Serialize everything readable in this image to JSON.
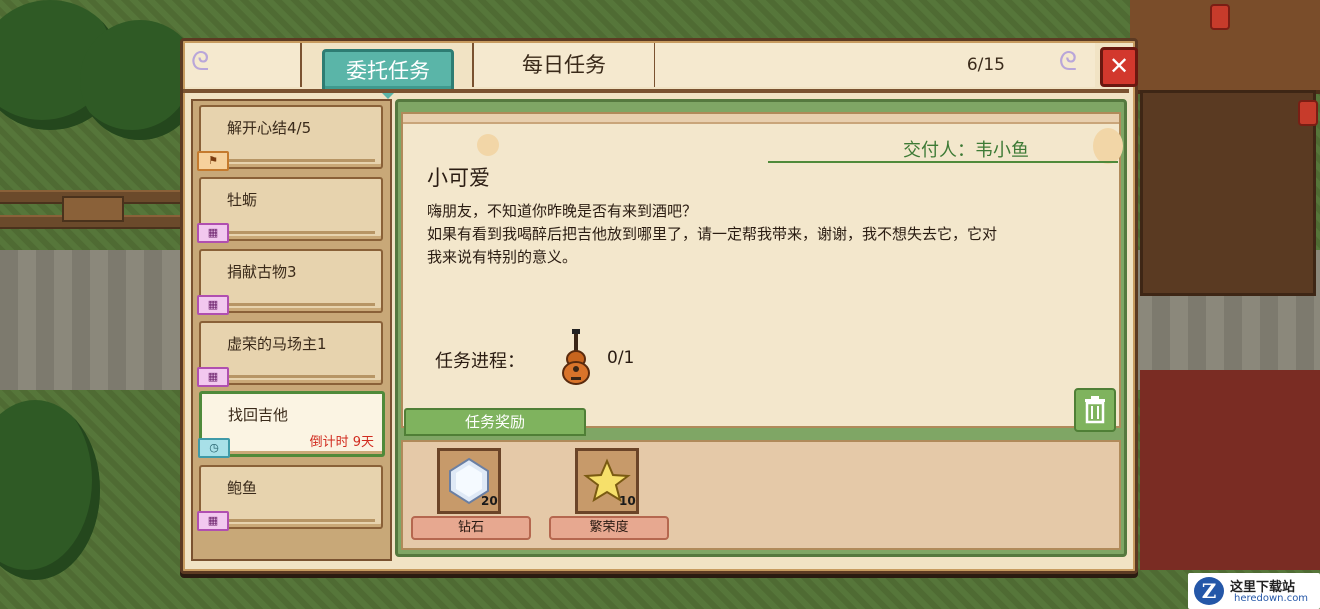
{
  "tabs": {
    "active_label": "委托任务",
    "inactive_label": "每日任务",
    "task_count": "6/15"
  },
  "task_list": [
    {
      "name": "解开心结4/5",
      "badge": "flag-icon",
      "badge_color": "#c47a2e"
    },
    {
      "name": "牡蛎",
      "badge": "calendar-icon",
      "badge_color": "#b04fb0"
    },
    {
      "name": "捐献古物3",
      "badge": "calendar-icon",
      "badge_color": "#b04fb0"
    },
    {
      "name": "虚荣的马场主1",
      "badge": "calendar-icon",
      "badge_color": "#b04fb0"
    },
    {
      "name": "找回吉他",
      "badge": "clock-icon",
      "badge_color": "#3f9aa8",
      "countdown": "倒计时 9天",
      "selected": true
    },
    {
      "name": "鲍鱼",
      "badge": "calendar-icon",
      "badge_color": "#b04fb0"
    }
  ],
  "detail": {
    "giver": "交付人：韦小鱼",
    "title": "小可爱",
    "description_lines": [
      "嗨朋友，不知道你昨晚是否有来到酒吧？",
      "如果有看到我喝醉后把吉他放到哪里了，请一定帮我带来，谢谢，我不想失去它，它对",
      "我来说有特别的意义。"
    ],
    "progress_label": "任务进程：",
    "progress_item_icon": "guitar-icon",
    "progress_value": "0/1",
    "reward_tab_label": "任务奖励"
  },
  "rewards": [
    {
      "name": "钻石",
      "quantity": "20",
      "icon": "diamond-icon"
    },
    {
      "name": "繁荣度",
      "quantity": "10",
      "icon": "star-icon"
    }
  ],
  "watermark": {
    "logo": "Z",
    "title": "这里下载站",
    "url": "heredown.com"
  },
  "colors": {
    "active_tab": "#5ab5a8",
    "panel_bg": "#f1e3c4",
    "giver_text": "#3d7a35",
    "countdown_text": "#d12b1f",
    "close_button": "#d2382d"
  }
}
